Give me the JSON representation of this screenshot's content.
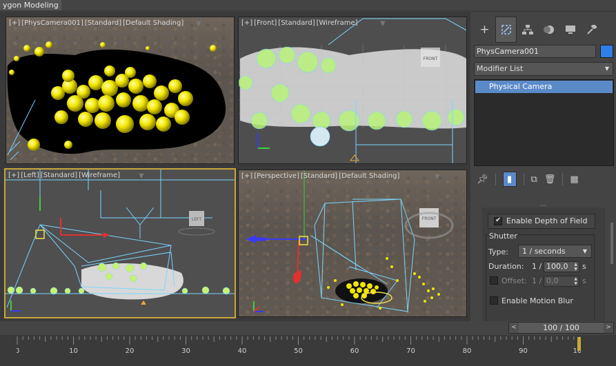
{
  "ribbon": {
    "tab_label": "ygon Modeling"
  },
  "viewports": {
    "top_left": {
      "labels": [
        "[+]",
        "[PhysCamera001]",
        "[Standard]",
        "[Default Shading]"
      ]
    },
    "top_right": {
      "labels": [
        "[+]",
        "[Front]",
        "[Standard]",
        "[Wireframe]"
      ],
      "cube_label": "FRONT"
    },
    "bottom_left": {
      "labels": [
        "[+]",
        "[Left]",
        "[Standard]",
        "[Wireframe]"
      ],
      "cube_label": "LEFT"
    },
    "bottom_right": {
      "labels": [
        "[+]",
        "[Perspective]",
        "[Standard]",
        "[Default Shading]"
      ],
      "cube_label": "FRONT"
    }
  },
  "command_panel": {
    "tabs": [
      "create-icon",
      "modify-icon",
      "hierarchy-icon",
      "motion-icon",
      "display-icon",
      "utilities-icon"
    ],
    "object_name": "PhysCamera001",
    "object_color": "#2f7fe8",
    "modifier_list": "Modifier List",
    "stack_items": [
      "Physical Camera"
    ],
    "dof_label": "Enable Depth of Field",
    "dof_checked": true,
    "shutter": {
      "title": "Shutter",
      "type_label": "Type:",
      "type_value": "1 / seconds",
      "duration_label": "Duration:",
      "duration_prefix": "1 /",
      "duration_value": "100,0",
      "duration_unit": "s",
      "offset_label": "Offset:",
      "offset_prefix": "1 /",
      "offset_value": "0,0",
      "offset_unit": "s",
      "motion_blur_label": "Enable Motion Blur"
    }
  },
  "timeline": {
    "slider_value": "100 / 100",
    "prev_label": "<",
    "next_label": ">",
    "ticks": [
      "0",
      "10",
      "20",
      "30",
      "40",
      "50",
      "60",
      "70",
      "80",
      "90",
      "100"
    ],
    "current_frame": 100
  },
  "colors": {
    "accent": "#c7a83a",
    "selection": "#5b8ac9",
    "sphere": "#f2e600"
  }
}
